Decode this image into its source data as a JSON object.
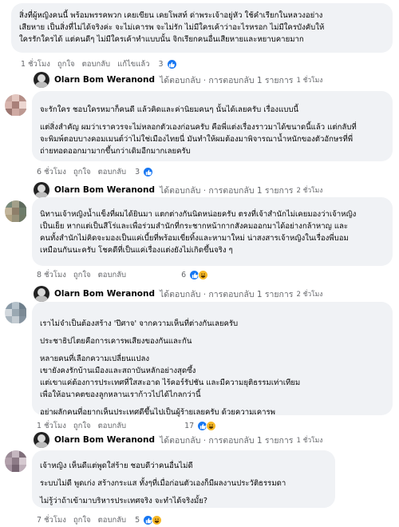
{
  "colors": {
    "bubble": "#f0f2f5",
    "meta": "#65676b",
    "like": "#1877f2",
    "haha": "#f7b928"
  },
  "comments": [
    {
      "lines": [
        "สิ่งที่ผู้หญิงคนนี้ พร้อมพรรคพวก เคยเขียน เคยโพสท์ ด่าพระเจ้าอยู่หัว ใช้คำเรียกในหลวงอย่าง",
        "เสียหาย เป็นสิ่งที่ไม่ได้จริงค่ะ จะไม่เคารพ จะไม่รัก ไม่มีใครเค้าว่าอะไรหรอก ไม่มีใครบังคับให้",
        "ใครรักใครได้ แต่คนดีๆ ไม่มีใครเค้าทำแบบนั้น จิกเรียกคนอื่นเสียหายและหยาบคายมาก"
      ],
      "time": "1 ชั่วโมง",
      "like": "ถูกใจ",
      "reply": "ตอบกลับ",
      "edited": "แก้ไขแล้ว",
      "reactions": "3",
      "reply_summary": {
        "name": "Olarn Bom Weranond",
        "text": "ได้ตอบกลับ · การตอบกลับ 1 รายการ",
        "time": "1 ชั่วโมง"
      }
    },
    {
      "lines": [
        "จะรักใคร ชอบใครหมาก็คนดี แล้วคิดและค่านิยมคนๆ นั้นได้เลยครับ เรื่องแบบนี้",
        "แต่สิ่งสำคัญ ผมว่าเราควรจะไม่หลอกตัวเองก่อนครับ คือพี่แต่งเรื่องราวมาได้ขนาดนี้แล้ว แต่กลับที่",
        "จะพิมพ์ตอบบางคอมเมนต์ว่าไม่ใช่เมืองไทยนี่ มันทำให้ผมต้องมาพิจารณาน้ำหนักของตัวอักษรที่พี่",
        "ถ่ายทอดออกมามากขึ้นกว่าเดิมอีกมากเลยครับ"
      ],
      "time": "6 ชั่วโมง",
      "like": "ถูกใจ",
      "reply": "ตอบกลับ",
      "reactions": "3",
      "reply_summary": {
        "name": "Olarn Bom Weranond",
        "text": "ได้ตอบกลับ · การตอบกลับ 1 รายการ",
        "time": "2 ชั่วโมง"
      }
    },
    {
      "lines": [
        "นิทานเจ้าหญิงน้ำแข็งที่ผมได้ยินมา แตกต่างกันนิดหน่อยครับ ตรงที่เจ้าสำนักไม่เคยมองว่าเจ้าหญิง",
        "เป็นเย็ย หากแต่เป็นสีโร่และเพื่อร่วมสำนักที่กระชากหน้ากากสังคมออกมาได้อย่างกล้าหาญ และ",
        "คนทั้งสำนักไม่คิดจะมองเป็นแค่เบี้ยที่พร้อมเขี่ยทิ้งและหามาใหม่ น่าสงสารเจ้าหญิงในเรื่องพี่บอม",
        "เหมือนกันนะครับ โชคดีที่เป็นแค่เรื่องแต่งยังไม่เกิดขึ้นจริง ๆ"
      ],
      "time": "8 ชั่วโมง",
      "like": "ถูกใจ",
      "reply": "ตอบกลับ",
      "reactions": "6",
      "reply_summary": {
        "name": "Olarn Bom Weranond",
        "text": "ได้ตอบกลับ · การตอบกลับ 1 รายการ",
        "time": "2 ชั่วโมง"
      }
    },
    {
      "lines": [
        "เราไม่จำเป็นต้องสร้าง 'ปีศาจ' จากความเห็นที่ต่างกันเลยครับ",
        "ประชาธิปไตยคือการเคารพเสียงของกันและกัน",
        "หลายคนที่เลือกความเปลี่ยนแปลง",
        "เขายังคงรักบ้านเมืองและสถาบันหลักอย่างสุดซึ้ง",
        "แต่เขาแค่ต้องการประเทศที่ใสสะอาด ไร้คอร์รัปชัน และมีความยุติธรรมเท่าเทียม",
        "เพื่อให้อนาคตของลูกหลานเราก้าวไปได้ไกลกว่านี้",
        "อย่าผลักคนที่อยากเห็นประเทศดีขึ้นไปเป็นผู้ร้ายเลยครับ ด้วยความเคารพ"
      ],
      "time": "1 ชั่วโมง",
      "like": "ถูกใจ",
      "reply": "ตอบกลับ",
      "reactions": "17",
      "reply_summary": {
        "name": "Olarn Bom Weranond",
        "text": "ได้ตอบกลับ · การตอบกลับ 1 รายการ",
        "time": "1 ชั่วโมง"
      }
    },
    {
      "lines": [
        "เจ้าหญิง เห็นดีแต่พูดใส่ร้าย ชอบดีว่าคนอื่นไม่ดี",
        "ระบบไม่ดี พูดเก่ง สร้างกระแส ทั้งๆที่เมื่อก่อนตัวเองก็มีผลงานประวัติธรรมดา",
        "ไม่รู้ว่าถ้าเข้ามาบริหารประเทศจริง จะทำได้จริงมั้ย?"
      ],
      "time": "7 ชั่วโมง",
      "like": "ถูกใจ",
      "reply": "ตอบกลับ",
      "reactions": "5"
    }
  ]
}
